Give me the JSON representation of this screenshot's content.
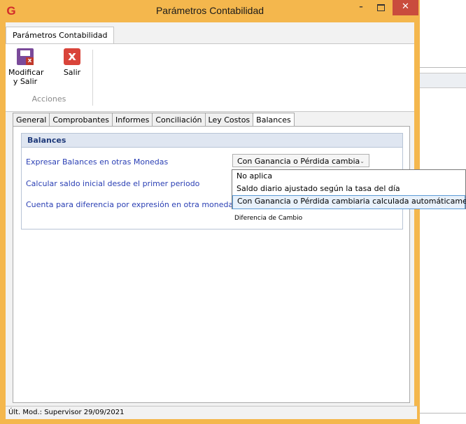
{
  "window": {
    "title": "Parámetros Contabilidad",
    "app_icon": "G",
    "minimize": "–",
    "close": "✕"
  },
  "ribbon": {
    "tab_label": "Parámetros Contabilidad",
    "buttons": [
      {
        "label_line1": "Modificar",
        "label_line2": "y Salir",
        "icon": "save-icon"
      },
      {
        "label_line1": "Salir",
        "label_line2": "",
        "icon": "exit-icon",
        "glyph": "x"
      }
    ],
    "group_label": "Acciones"
  },
  "tabs": [
    {
      "label": "General",
      "active": false
    },
    {
      "label": "Comprobantes",
      "active": false
    },
    {
      "label": "Informes",
      "active": false
    },
    {
      "label": "Conciliación",
      "active": false
    },
    {
      "label": "Ley Costos",
      "active": false
    },
    {
      "label": "Balances",
      "active": true
    }
  ],
  "balances": {
    "header": "Balances",
    "fields": [
      {
        "label": "Expresar Balances en otras Monedas"
      },
      {
        "label": "Calcular saldo inicial desde el primer periodo"
      },
      {
        "label": "Cuenta para diferencia por expresión en otra moneda"
      }
    ],
    "combo_value": "Con Ganancia o Pérdida cambia",
    "dropdown_options": [
      "No aplica",
      "Saldo diario ajustado según la tasa del día",
      "Con Ganancia o Pérdida cambiaria calculada automáticament"
    ],
    "selected_option_index": 2,
    "account_hint": "Diferencia de Cambio"
  },
  "status_bar": {
    "text": "Últ. Mod.: Supervisor  29/09/2021"
  },
  "colors": {
    "window_frame": "#f4b74d",
    "close_button": "#c94c3d",
    "label_blue": "#2a3fb4",
    "group_header_bg": "#dfe6f1"
  }
}
